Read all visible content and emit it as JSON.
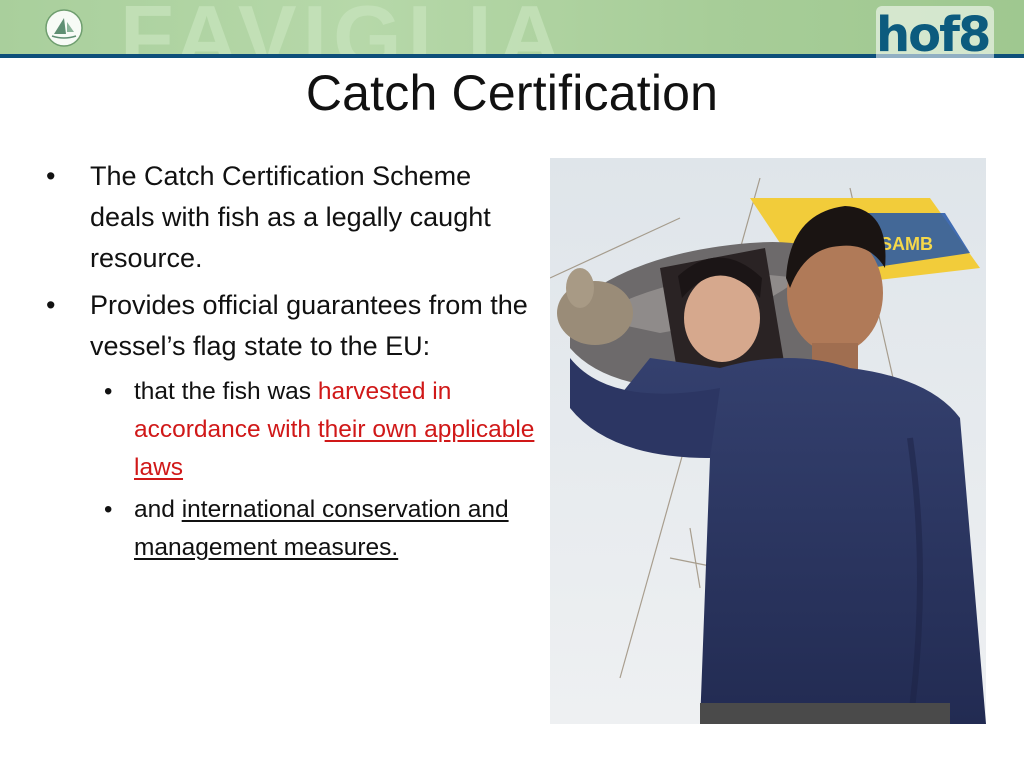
{
  "header": {
    "watermark_text": "FAVIGLIA",
    "event_logo_text": "hof8"
  },
  "slide": {
    "title": "Catch Certification",
    "bullets": [
      {
        "text": "The Catch Certification Scheme deals with fish as a legally caught resource."
      },
      {
        "text": "Provides official guarantees from the vessel’s flag state to the EU:",
        "sub": [
          {
            "prefix": "that the fish was ",
            "red": "harvested in accordance with t",
            "red_underlined": "heir own applicable laws"
          },
          {
            "prefix": "and ",
            "underlined": "international conservation and management measures."
          }
        ]
      }
    ]
  },
  "photo": {
    "description_icon": "fisherman-carrying-tuna-photo",
    "jacket_text": "SAMB"
  },
  "colors": {
    "banner_green": "#b6d8a9",
    "banner_rule": "#0d4f7a",
    "highlight_red": "#d01818",
    "logo_blue": "#0c5b7e"
  }
}
